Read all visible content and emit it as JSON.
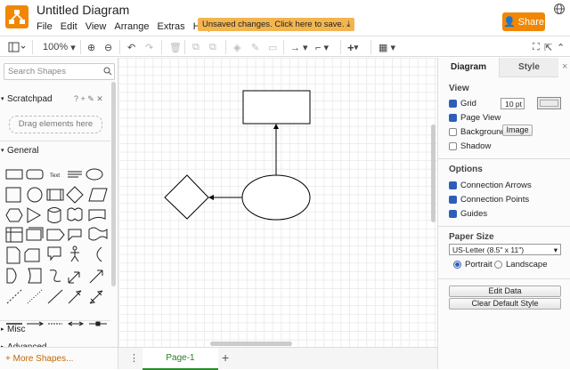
{
  "app": {
    "title": "Untitled Diagram",
    "unsaved_notice": "Unsaved changes. Click here to save.",
    "share_label": "Share"
  },
  "menu": [
    "File",
    "Edit",
    "View",
    "Arrange",
    "Extras",
    "Help"
  ],
  "toolbar": {
    "zoom": "100%"
  },
  "left": {
    "search_placeholder": "Search Shapes",
    "scratchpad_title": "Scratchpad",
    "scratchpad_tools": "? + ✎ ✕",
    "scratchpad_drop": "Drag elements here",
    "general_title": "General",
    "misc_title": "Misc",
    "advanced_title": "Advanced",
    "text_shape": "Text",
    "more_shapes": "+ More Shapes..."
  },
  "page": {
    "tab": "Page-1"
  },
  "right": {
    "tab_diagram": "Diagram",
    "tab_style": "Style",
    "view_title": "View",
    "grid_label": "Grid",
    "grid_size": "10 pt",
    "page_view_label": "Page View",
    "background_label": "Background",
    "image_button": "Image",
    "shadow_label": "Shadow",
    "options_title": "Options",
    "connection_arrows_label": "Connection Arrows",
    "connection_points_label": "Connection Points",
    "guides_label": "Guides",
    "paper_size_title": "Paper Size",
    "paper_size_value": "US-Letter (8.5\" x 11\")",
    "portrait_label": "Portrait",
    "landscape_label": "Landscape",
    "edit_data_button": "Edit Data",
    "clear_style_button": "Clear Default Style"
  },
  "colors": {
    "accent": "#f08705",
    "unsaved_bg": "#f2b54f",
    "checkbox": "#2d5fb6",
    "page_tab": "#2a7c2a"
  }
}
